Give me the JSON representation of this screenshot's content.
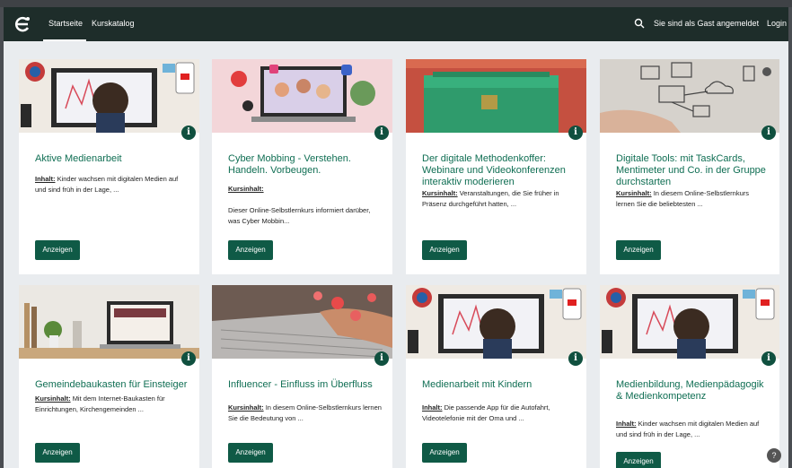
{
  "nav": {
    "home": "Startseite",
    "catalog": "Kurskatalog",
    "guest_notice": "Sie sind als Gast angemeldet",
    "login": "Login"
  },
  "cards": [
    {
      "title": "Aktive Medienarbeit",
      "summary_label": "Inhalt:",
      "summary": "Kinder wachsen mit digitalen Medien auf und sind früh in der Lage, ...",
      "button": "Anzeigen"
    },
    {
      "title": "Cyber Mobbing - Verstehen. Handeln. Vorbeugen.",
      "summary_label": "Kursinhalt:",
      "summary": "Dieser Online-Selbstlernkurs informiert darüber, was Cyber Mobbin...",
      "button": "Anzeigen"
    },
    {
      "title": "Der digitale Methodenkoffer: Webinare und Videokonferenzen interaktiv moderieren",
      "summary_label": "Kursinhalt:",
      "summary": "Veranstaltungen, die Sie früher in Präsenz durchgeführt hatten, ...",
      "button": "Anzeigen"
    },
    {
      "title": "Digitale Tools: mit TaskCards, Mentimeter und Co. in der Gruppe durchstarten",
      "summary_label": "Kursinhalt:",
      "summary": "In diesem Online-Selbstlernkurs lernen Sie die beliebtesten ...",
      "button": "Anzeigen"
    },
    {
      "title": "Gemeindebaukasten für Einsteiger",
      "summary_label": "Kursinhalt:",
      "summary": "Mit dem Internet-Baukasten für Einrichtungen, Kirchengemeinden ...",
      "button": "Anzeigen"
    },
    {
      "title": "Influencer - Einfluss im Überfluss",
      "summary_label": "Kursinhalt:",
      "summary": "In diesem Online-Selbstlernkurs lernen Sie die Bedeutung von ...",
      "button": "Anzeigen"
    },
    {
      "title": "Medienarbeit mit Kindern",
      "summary_label": "Inhalt:",
      "summary": "Die passende App für die Autofahrt, Videotelefonie mit der Oma und ...",
      "button": "Anzeigen"
    },
    {
      "title": "Medienbildung, Medienpädagogik & Medienkompetenz",
      "summary_label": "Inhalt:",
      "summary": "Kinder wachsen mit digitalen Medien auf und sind früh in der Lage, ...",
      "button": "Anzeigen"
    }
  ],
  "help": "?"
}
